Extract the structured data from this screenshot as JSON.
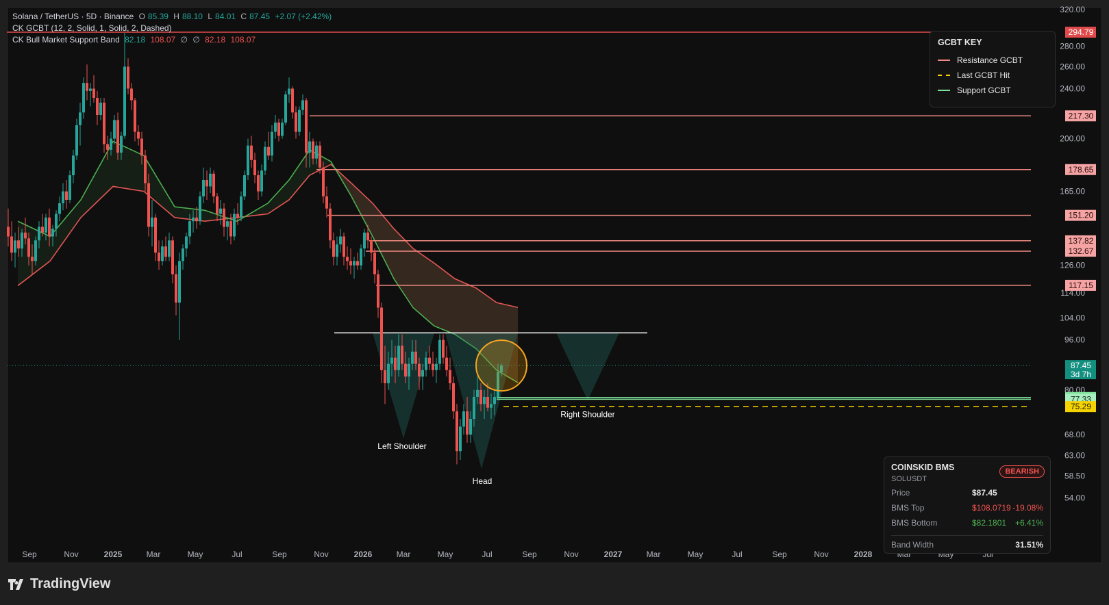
{
  "header": {
    "symbol": "Solana / TetherUS · 5D · Binance",
    "o_label": "O",
    "o": "85.39",
    "h_label": "H",
    "h": "88.10",
    "l_label": "L",
    "l": "84.01",
    "c_label": "C",
    "c": "87.45",
    "change": "+2.07 (+2.42%)",
    "indicator1": "CK GCBT (12, 2, Solid, 1, Solid, 2, Dashed)",
    "indicator2": "CK Bull Market Support Band",
    "band_v1": "82.18",
    "band_v2": "108.07",
    "band_na1": "∅",
    "band_na2": "∅",
    "band_v3": "82.18",
    "band_v4": "108.07"
  },
  "key_panel": {
    "title": "GCBT KEY",
    "items": [
      {
        "label": "Resistance GCBT",
        "color": "#f28b82",
        "style": "solid"
      },
      {
        "label": "Last GCBT Hit",
        "color": "#f5d300",
        "style": "dashed"
      },
      {
        "label": "Support GCBT",
        "color": "#7ee29a",
        "style": "solid"
      }
    ]
  },
  "bms_panel": {
    "title": "COINSKID BMS",
    "symbol": "SOLUSDT",
    "badge": "BEARISH",
    "price_label": "Price",
    "price": "$87.45",
    "top_label": "BMS Top",
    "top": "$108.0719",
    "top_pct": "-19.08%",
    "bottom_label": "BMS Bottom",
    "bottom": "$82.1801",
    "bottom_pct": "+6.41%",
    "width_label": "Band Width",
    "width": "31.51%"
  },
  "logo": "TradingView",
  "chart_data": {
    "type": "candlestick",
    "x_axis_labels": [
      "Sep",
      "Nov",
      "2025",
      "Mar",
      "May",
      "Jul",
      "Sep",
      "Nov",
      "2026",
      "Mar",
      "May",
      "Jul",
      "Sep",
      "Nov",
      "2027",
      "Mar",
      "May",
      "Jul",
      "Sep",
      "Nov",
      "2028",
      "Mar",
      "May",
      "Jul"
    ],
    "y_axis_ticks": [
      "320.00",
      "280.00",
      "260.00",
      "240.00",
      "200.00",
      "165.00",
      "126.00",
      "114.00",
      "104.00",
      "96.00",
      "80.00",
      "68.00",
      "63.00",
      "58.50",
      "54.00"
    ],
    "y_scale": "log",
    "current_price": "87.45",
    "countdown": "3d 7h",
    "resistance_levels": [
      "294.79",
      "217.30",
      "178.65",
      "151.20",
      "137.82",
      "132.67",
      "117.15"
    ],
    "support_levels": [
      "77.84",
      "77.33"
    ],
    "last_hit_level": "75.29",
    "neckline": 98.5,
    "annotations": [
      "Left Shoulder",
      "Head",
      "Right Shoulder"
    ],
    "colors": {
      "up": "#26a69a",
      "down": "#ef5350",
      "resistance": "#f28b82",
      "support": "#7ee29a",
      "last_hit": "#f5d300",
      "band_green": "#4caf50",
      "band_red": "#e35555"
    },
    "band_top": [
      [
        "2024-08-15",
        117
      ],
      [
        "2024-10-01",
        128
      ],
      [
        "2024-11-15",
        150
      ],
      [
        "2025-01-01",
        168
      ],
      [
        "2025-02-15",
        165
      ],
      [
        "2025-04-01",
        150
      ],
      [
        "2025-05-15",
        148
      ],
      [
        "2025-07-01",
        150
      ],
      [
        "2025-08-15",
        152
      ],
      [
        "2025-09-15",
        160
      ],
      [
        "2025-10-15",
        175
      ],
      [
        "2025-11-15",
        182
      ],
      [
        "2025-12-15",
        170
      ],
      [
        "2026-01-15",
        158
      ],
      [
        "2026-02-15",
        144
      ],
      [
        "2026-03-15",
        134
      ],
      [
        "2026-04-15",
        127
      ],
      [
        "2026-05-15",
        120
      ],
      [
        "2026-06-15",
        116
      ],
      [
        "2026-07-15",
        110
      ],
      [
        "2026-08-15",
        108.07
      ]
    ],
    "band_bottom": [
      [
        "2024-08-15",
        148
      ],
      [
        "2024-10-01",
        140
      ],
      [
        "2024-11-15",
        160
      ],
      [
        "2025-01-01",
        198
      ],
      [
        "2025-02-15",
        188
      ],
      [
        "2025-04-01",
        156
      ],
      [
        "2025-05-15",
        154
      ],
      [
        "2025-07-01",
        148
      ],
      [
        "2025-08-15",
        158
      ],
      [
        "2025-09-15",
        172
      ],
      [
        "2025-10-15",
        192
      ],
      [
        "2025-11-15",
        184
      ],
      [
        "2025-12-15",
        162
      ],
      [
        "2026-01-15",
        140
      ],
      [
        "2026-02-15",
        120
      ],
      [
        "2026-03-15",
        108
      ],
      [
        "2026-04-15",
        101
      ],
      [
        "2026-05-15",
        98
      ],
      [
        "2026-06-15",
        93
      ],
      [
        "2026-07-15",
        86
      ],
      [
        "2026-08-15",
        82.18
      ]
    ],
    "candles": [
      [
        "2024-08-01",
        145,
        155,
        135,
        140
      ],
      [
        "2024-08-06",
        140,
        148,
        128,
        132
      ],
      [
        "2024-08-11",
        132,
        142,
        125,
        138
      ],
      [
        "2024-08-16",
        138,
        145,
        130,
        134
      ],
      [
        "2024-08-21",
        134,
        144,
        130,
        142
      ],
      [
        "2024-08-26",
        142,
        150,
        136,
        139
      ],
      [
        "2024-08-31",
        139,
        142,
        126,
        130
      ],
      [
        "2024-09-05",
        130,
        136,
        122,
        128
      ],
      [
        "2024-09-10",
        128,
        140,
        126,
        138
      ],
      [
        "2024-09-15",
        138,
        148,
        134,
        145
      ],
      [
        "2024-09-20",
        145,
        152,
        140,
        142
      ],
      [
        "2024-09-25",
        142,
        152,
        138,
        150
      ],
      [
        "2024-09-30",
        150,
        155,
        135,
        140
      ],
      [
        "2024-10-05",
        140,
        146,
        135,
        144
      ],
      [
        "2024-10-10",
        144,
        154,
        140,
        152
      ],
      [
        "2024-10-15",
        152,
        162,
        148,
        158
      ],
      [
        "2024-10-20",
        158,
        170,
        154,
        165
      ],
      [
        "2024-10-25",
        165,
        172,
        155,
        160
      ],
      [
        "2024-10-30",
        160,
        178,
        158,
        175
      ],
      [
        "2024-11-04",
        175,
        192,
        170,
        188
      ],
      [
        "2024-11-09",
        188,
        215,
        185,
        210
      ],
      [
        "2024-11-14",
        210,
        228,
        195,
        220
      ],
      [
        "2024-11-19",
        220,
        250,
        215,
        245
      ],
      [
        "2024-11-24",
        245,
        262,
        230,
        238
      ],
      [
        "2024-11-29",
        238,
        245,
        225,
        240
      ],
      [
        "2024-12-04",
        240,
        252,
        228,
        232
      ],
      [
        "2024-12-09",
        232,
        238,
        210,
        218
      ],
      [
        "2024-12-14",
        218,
        232,
        214,
        228
      ],
      [
        "2024-12-19",
        228,
        232,
        190,
        196
      ],
      [
        "2024-12-24",
        196,
        202,
        185,
        192
      ],
      [
        "2024-12-29",
        192,
        205,
        188,
        200
      ],
      [
        "2025-01-03",
        200,
        218,
        196,
        214
      ],
      [
        "2025-01-08",
        214,
        220,
        185,
        190
      ],
      [
        "2025-01-13",
        190,
        205,
        185,
        202
      ],
      [
        "2025-01-18",
        202,
        294,
        200,
        260
      ],
      [
        "2025-01-23",
        260,
        268,
        235,
        240
      ],
      [
        "2025-01-28",
        240,
        245,
        222,
        230
      ],
      [
        "2025-02-02",
        230,
        232,
        198,
        205
      ],
      [
        "2025-02-07",
        205,
        210,
        195,
        200
      ],
      [
        "2025-02-12",
        200,
        205,
        182,
        188
      ],
      [
        "2025-02-17",
        188,
        192,
        165,
        170
      ],
      [
        "2025-02-22",
        170,
        176,
        140,
        145
      ],
      [
        "2025-02-27",
        145,
        160,
        135,
        150
      ],
      [
        "2025-03-04",
        150,
        152,
        128,
        132
      ],
      [
        "2025-03-09",
        132,
        138,
        124,
        128
      ],
      [
        "2025-03-14",
        128,
        138,
        126,
        135
      ],
      [
        "2025-03-19",
        135,
        140,
        128,
        130
      ],
      [
        "2025-03-24",
        130,
        142,
        128,
        138
      ],
      [
        "2025-03-29",
        138,
        140,
        118,
        122
      ],
      [
        "2025-04-03",
        122,
        126,
        105,
        110
      ],
      [
        "2025-04-08",
        110,
        132,
        96,
        128
      ],
      [
        "2025-04-13",
        128,
        136,
        124,
        134
      ],
      [
        "2025-04-18",
        134,
        142,
        130,
        140
      ],
      [
        "2025-04-23",
        140,
        152,
        136,
        148
      ],
      [
        "2025-04-28",
        148,
        154,
        142,
        150
      ],
      [
        "2025-05-03",
        150,
        156,
        144,
        148
      ],
      [
        "2025-05-08",
        148,
        165,
        146,
        162
      ],
      [
        "2025-05-13",
        162,
        180,
        158,
        172
      ],
      [
        "2025-05-18",
        172,
        178,
        160,
        168
      ],
      [
        "2025-05-23",
        168,
        180,
        164,
        176
      ],
      [
        "2025-05-28",
        176,
        178,
        158,
        162
      ],
      [
        "2025-06-02",
        162,
        164,
        148,
        152
      ],
      [
        "2025-06-07",
        152,
        160,
        146,
        155
      ],
      [
        "2025-06-12",
        155,
        158,
        140,
        145
      ],
      [
        "2025-06-17",
        145,
        150,
        138,
        148
      ],
      [
        "2025-06-22",
        148,
        152,
        136,
        140
      ],
      [
        "2025-06-27",
        140,
        155,
        138,
        152
      ],
      [
        "2025-07-02",
        152,
        158,
        146,
        150
      ],
      [
        "2025-07-07",
        150,
        165,
        148,
        162
      ],
      [
        "2025-07-12",
        162,
        178,
        160,
        175
      ],
      [
        "2025-07-17",
        175,
        200,
        172,
        195
      ],
      [
        "2025-07-22",
        195,
        202,
        180,
        185
      ],
      [
        "2025-07-27",
        185,
        190,
        170,
        175
      ],
      [
        "2025-08-01",
        175,
        178,
        160,
        165
      ],
      [
        "2025-08-06",
        165,
        182,
        162,
        178
      ],
      [
        "2025-08-11",
        178,
        198,
        175,
        194
      ],
      [
        "2025-08-16",
        194,
        205,
        185,
        188
      ],
      [
        "2025-08-21",
        188,
        210,
        184,
        205
      ],
      [
        "2025-08-26",
        205,
        218,
        200,
        212
      ],
      [
        "2025-08-31",
        212,
        215,
        198,
        202
      ],
      [
        "2025-09-05",
        202,
        215,
        200,
        212
      ],
      [
        "2025-09-10",
        212,
        238,
        210,
        235
      ],
      [
        "2025-09-15",
        235,
        250,
        228,
        240
      ],
      [
        "2025-09-20",
        240,
        242,
        215,
        220
      ],
      [
        "2025-09-25",
        220,
        225,
        200,
        205
      ],
      [
        "2025-09-30",
        205,
        225,
        202,
        222
      ],
      [
        "2025-10-05",
        222,
        235,
        218,
        230
      ],
      [
        "2025-10-10",
        230,
        232,
        180,
        190
      ],
      [
        "2025-10-15",
        190,
        205,
        180,
        198
      ],
      [
        "2025-10-20",
        198,
        200,
        182,
        186
      ],
      [
        "2025-10-25",
        186,
        198,
        182,
        195
      ],
      [
        "2025-10-30",
        195,
        198,
        176,
        180
      ],
      [
        "2025-11-04",
        180,
        184,
        158,
        162
      ],
      [
        "2025-11-09",
        162,
        168,
        150,
        155
      ],
      [
        "2025-11-14",
        155,
        158,
        134,
        138
      ],
      [
        "2025-11-19",
        138,
        142,
        126,
        130
      ],
      [
        "2025-11-24",
        130,
        140,
        126,
        136
      ],
      [
        "2025-11-29",
        136,
        144,
        132,
        140
      ],
      [
        "2025-12-04",
        140,
        142,
        126,
        130
      ],
      [
        "2025-12-09",
        130,
        135,
        124,
        128
      ],
      [
        "2025-12-14",
        128,
        134,
        122,
        126
      ],
      [
        "2025-12-19",
        126,
        130,
        120,
        128
      ],
      [
        "2025-12-24",
        128,
        132,
        124,
        126
      ],
      [
        "2025-12-29",
        126,
        136,
        124,
        134
      ],
      [
        "2026-01-03",
        134,
        144,
        130,
        142
      ],
      [
        "2026-01-08",
        142,
        146,
        134,
        138
      ],
      [
        "2026-01-13",
        138,
        140,
        128,
        132
      ],
      [
        "2026-01-18",
        132,
        134,
        118,
        122
      ],
      [
        "2026-01-23",
        122,
        124,
        104,
        108
      ],
      [
        "2026-01-28",
        108,
        110,
        82,
        86
      ],
      [
        "2026-02-02",
        86,
        94,
        76,
        82
      ],
      [
        "2026-02-07",
        82,
        92,
        80,
        88
      ],
      [
        "2026-02-12",
        88,
        96,
        84,
        90
      ],
      [
        "2026-02-17",
        90,
        94,
        82,
        86
      ],
      [
        "2026-02-22",
        86,
        98,
        84,
        94
      ],
      [
        "2026-02-27",
        94,
        98,
        86,
        88
      ],
      [
        "2026-03-04",
        88,
        92,
        82,
        84
      ],
      [
        "2026-03-09",
        84,
        90,
        80,
        88
      ],
      [
        "2026-03-14",
        88,
        96,
        86,
        92
      ],
      [
        "2026-03-19",
        92,
        96,
        86,
        88
      ],
      [
        "2026-03-24",
        88,
        90,
        80,
        84
      ],
      [
        "2026-03-29",
        84,
        88,
        80,
        86
      ],
      [
        "2026-04-03",
        86,
        92,
        84,
        90
      ],
      [
        "2026-04-08",
        90,
        94,
        86,
        88
      ],
      [
        "2026-04-13",
        88,
        92,
        84,
        86
      ],
      [
        "2026-04-18",
        86,
        90,
        82,
        88
      ],
      [
        "2026-04-23",
        88,
        98,
        86,
        96
      ],
      [
        "2026-04-28",
        96,
        98,
        88,
        90
      ],
      [
        "2026-05-03",
        90,
        94,
        84,
        86
      ],
      [
        "2026-05-08",
        86,
        90,
        80,
        82
      ],
      [
        "2026-05-13",
        82,
        84,
        72,
        74
      ],
      [
        "2026-05-18",
        74,
        76,
        61,
        64
      ],
      [
        "2026-05-23",
        64,
        72,
        62,
        70
      ],
      [
        "2026-05-28",
        70,
        76,
        68,
        74
      ],
      [
        "2026-06-02",
        74,
        78,
        66,
        68
      ],
      [
        "2026-06-07",
        68,
        74,
        66,
        72
      ],
      [
        "2026-06-12",
        72,
        80,
        70,
        78
      ],
      [
        "2026-06-17",
        78,
        84,
        76,
        80
      ],
      [
        "2026-06-22",
        80,
        82,
        74,
        76
      ],
      [
        "2026-06-27",
        76,
        80,
        72,
        78
      ],
      [
        "2026-07-02",
        78,
        82,
        74,
        75
      ],
      [
        "2026-07-07",
        75,
        79,
        72,
        76
      ],
      [
        "2026-07-12",
        76,
        80,
        73,
        78
      ],
      [
        "2026-07-17",
        78,
        88,
        77,
        85.39
      ],
      [
        "2026-07-22",
        85.39,
        88.1,
        84.01,
        87.45
      ]
    ]
  }
}
